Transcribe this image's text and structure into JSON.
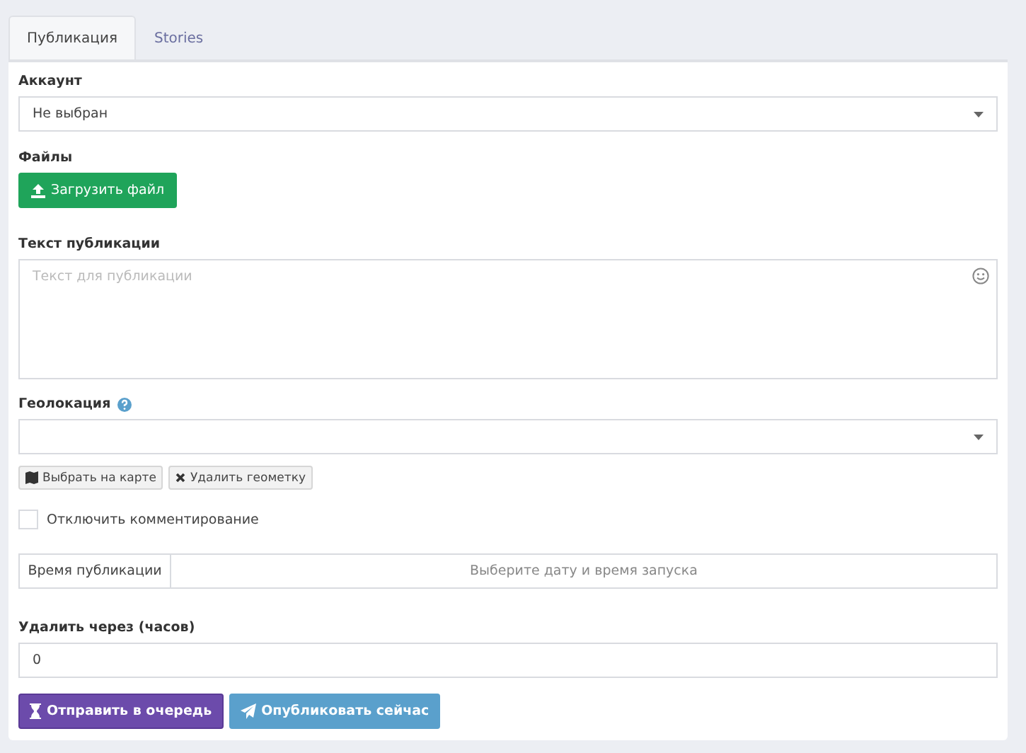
{
  "tabs": [
    {
      "label": "Публикация",
      "selected": true
    },
    {
      "label": "Stories",
      "selected": false
    }
  ],
  "account": {
    "label": "Аккаунт",
    "value": "Не выбран"
  },
  "files": {
    "label": "Файлы",
    "button": "Загрузить файл"
  },
  "text": {
    "label": "Текст публикации",
    "placeholder": "Текст для публикации"
  },
  "geolocation": {
    "label": "Геолокация",
    "buttons": [
      {
        "kind": "map",
        "label": "Выбрать на карте"
      },
      {
        "kind": "remove",
        "label": "Удалить геометку"
      }
    ]
  },
  "disable_comments": {
    "label": "Отключить комментирование",
    "checked": false
  },
  "publish_time": {
    "label": "Время публикации",
    "placeholder": "Выберите дату и время запуска"
  },
  "delete_after": {
    "label": "Удалить через (часов)",
    "value": "0"
  },
  "actions": [
    {
      "kind": "queue",
      "label": "Отправить в очередь"
    },
    {
      "kind": "publish",
      "label": "Опубликовать сейчас"
    }
  ]
}
